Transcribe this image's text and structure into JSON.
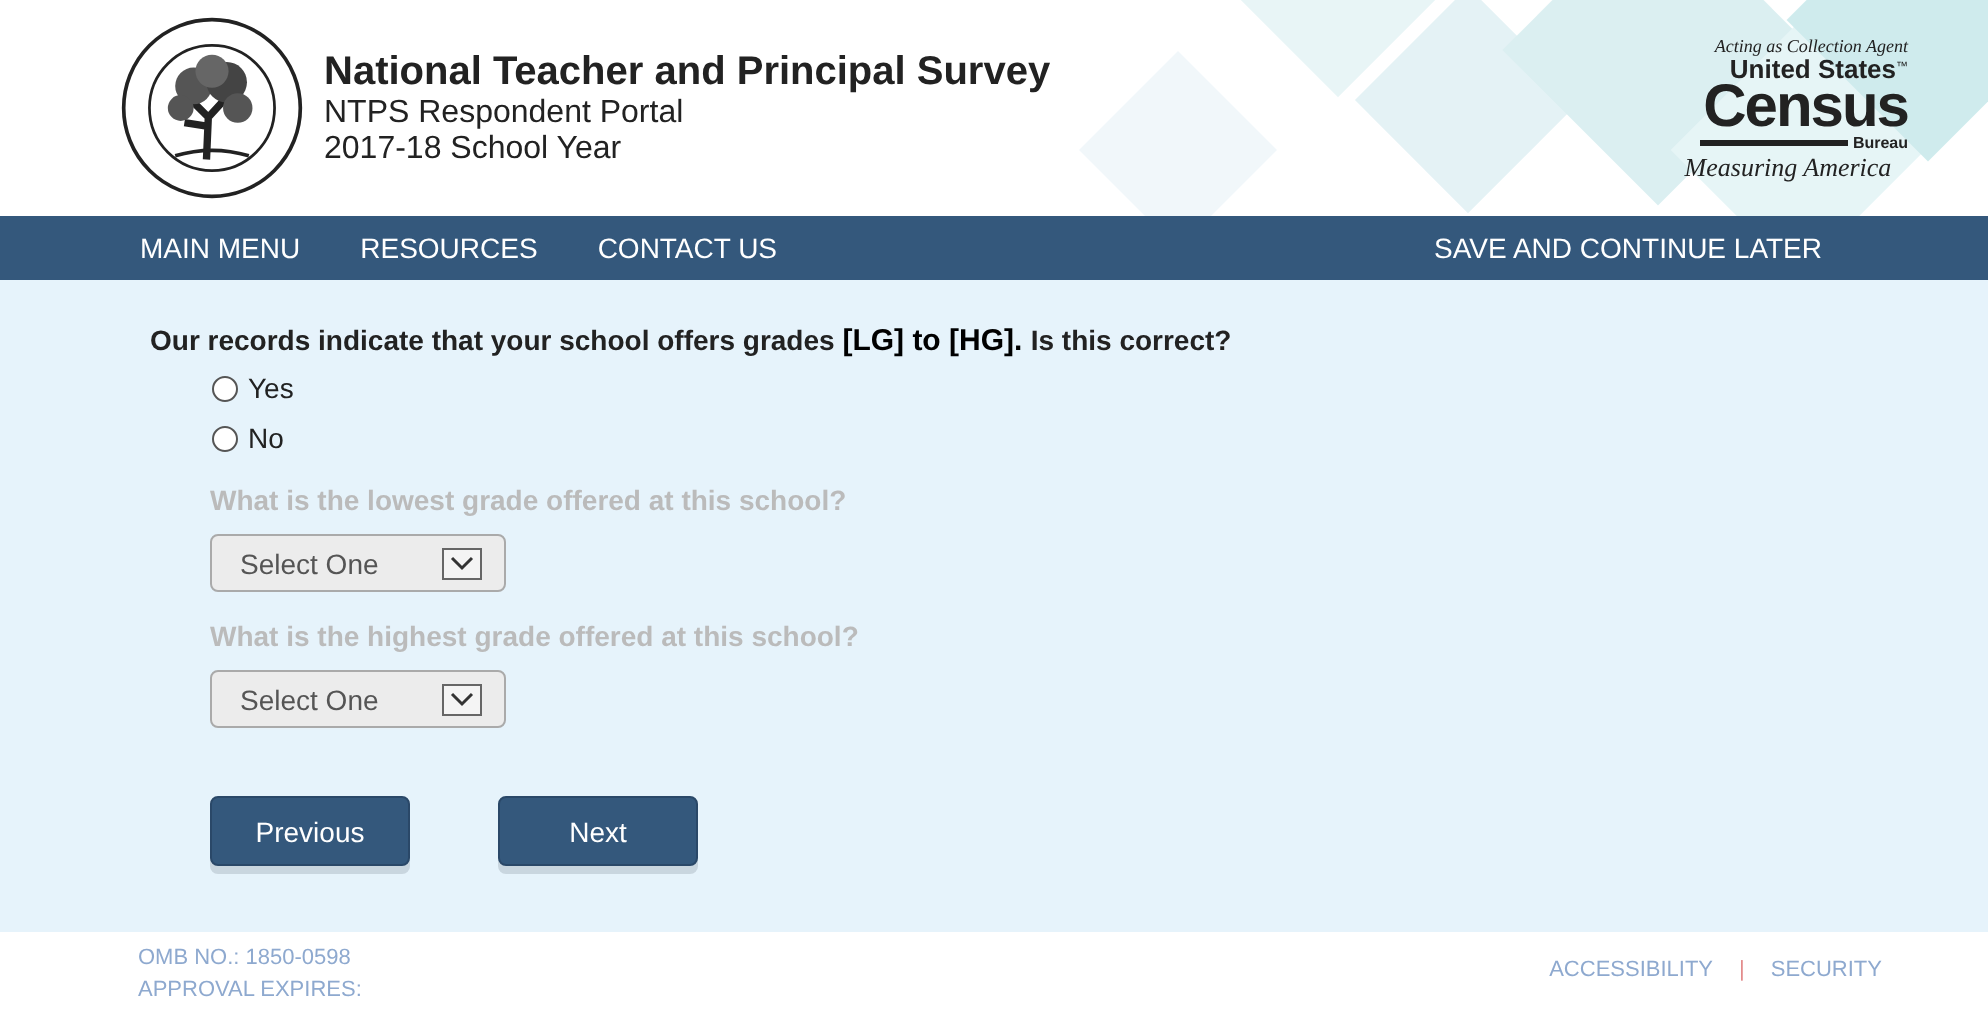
{
  "header": {
    "title": "National Teacher and Principal Survey",
    "subtitle": "NTPS Respondent Portal",
    "year": "2017-18 School Year",
    "agent": {
      "note": "Acting as Collection Agent",
      "org_top": "United States",
      "tm": "™",
      "org_main": "Census",
      "org_sub": "Bureau",
      "tagline": "Measuring America"
    }
  },
  "nav": {
    "left": [
      "MAIN MENU",
      "RESOURCES",
      "CONTACT US"
    ],
    "right": "SAVE AND CONTINUE LATER"
  },
  "question": {
    "lead": "Our records indicate that your school offers grades",
    "grades": "[LG] to [HG].",
    "tail": "Is this correct?"
  },
  "options": [
    {
      "label": "Yes",
      "selected": false
    },
    {
      "label": "No",
      "selected": false
    }
  ],
  "followups": [
    {
      "label": "What is the lowest grade offered at this school?",
      "value": "Select One",
      "disabled": true
    },
    {
      "label": "What is the highest grade offered at this school?",
      "value": "Select One",
      "disabled": true
    }
  ],
  "buttons": [
    "Previous",
    "Next"
  ],
  "footer": {
    "omb": "OMB NO.: 1850-0598",
    "expires": "APPROVAL EXPIRES:",
    "links": [
      "ACCESSIBILITY",
      "SECURITY"
    ],
    "separator": "|"
  }
}
